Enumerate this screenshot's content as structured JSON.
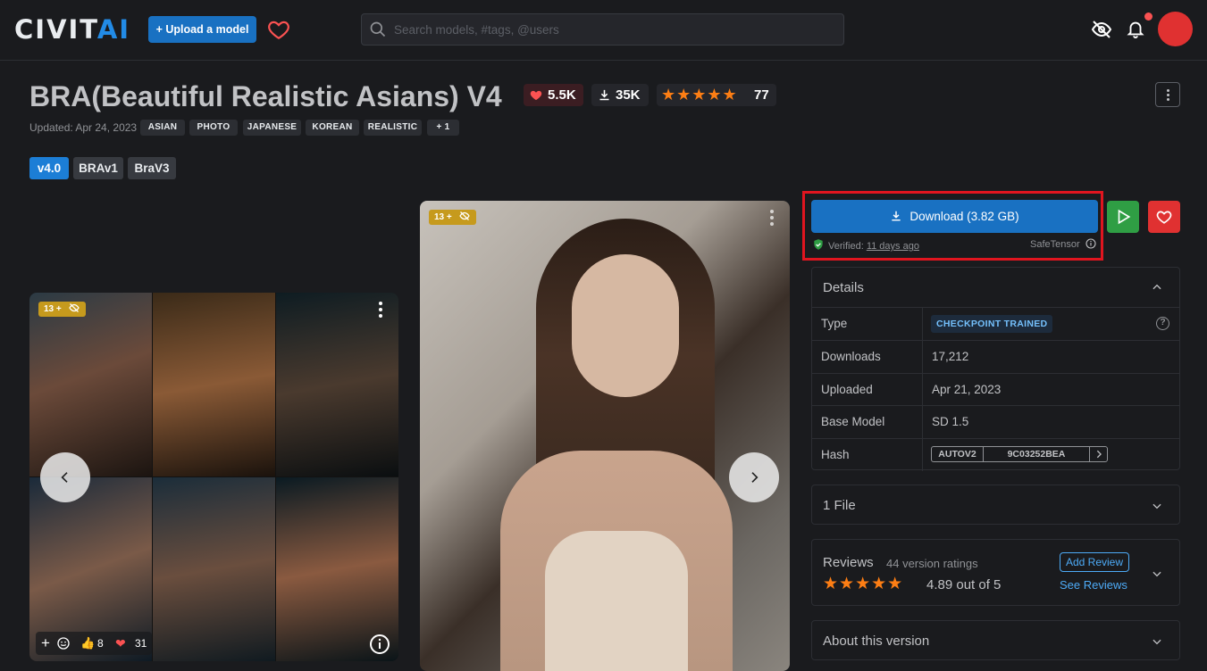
{
  "header": {
    "logo_main": "CIVIT",
    "logo_accent": "AI",
    "upload_label": "+ Upload a model",
    "search_placeholder": "Search models, #tags, @users"
  },
  "model": {
    "title": "BRA(Beautiful Realistic Asians) V4",
    "likes": "5.5K",
    "downloads": "35K",
    "rating_stars": "★★★★★",
    "rating_count": "77",
    "updated": "Updated: Apr 24, 2023",
    "tags": [
      "ASIAN",
      "PHOTO",
      "JAPANESE",
      "KOREAN",
      "REALISTIC",
      "+ 1"
    ],
    "versions": [
      "v4.0",
      "BRAv1",
      "BraV3"
    ]
  },
  "gallery": {
    "nsfw_badge": "13 +",
    "reaction_add": "+",
    "thumbs_count": "8",
    "hearts_count": "31"
  },
  "download": {
    "label": "Download (3.82 GB)",
    "verified_prefix": "Verified:",
    "verified_time": "11 days ago",
    "safetensor": "SafeTensor"
  },
  "details": {
    "heading": "Details",
    "rows": [
      {
        "label": "Type",
        "value": "CHECKPOINT TRAINED"
      },
      {
        "label": "Downloads",
        "value": "17,212"
      },
      {
        "label": "Uploaded",
        "value": "Apr 21, 2023"
      },
      {
        "label": "Base Model",
        "value": "SD 1.5"
      },
      {
        "label": "Hash",
        "value": "9C03252BEA"
      }
    ],
    "hash_type": "AUTOV2"
  },
  "files": {
    "heading": "1 File"
  },
  "reviews": {
    "heading": "Reviews",
    "count": "44 version ratings",
    "stars": "★★★★★",
    "score": "4.89 out of 5",
    "add_label": "Add Review",
    "see_label": "See Reviews"
  },
  "about": {
    "heading": "About this version"
  },
  "colors": {
    "accent_blue": "#1971c2",
    "download_highlight": "#e0151f",
    "play_green": "#2f9e44",
    "fav_red": "#e03131",
    "star_orange": "#fd7e14"
  }
}
